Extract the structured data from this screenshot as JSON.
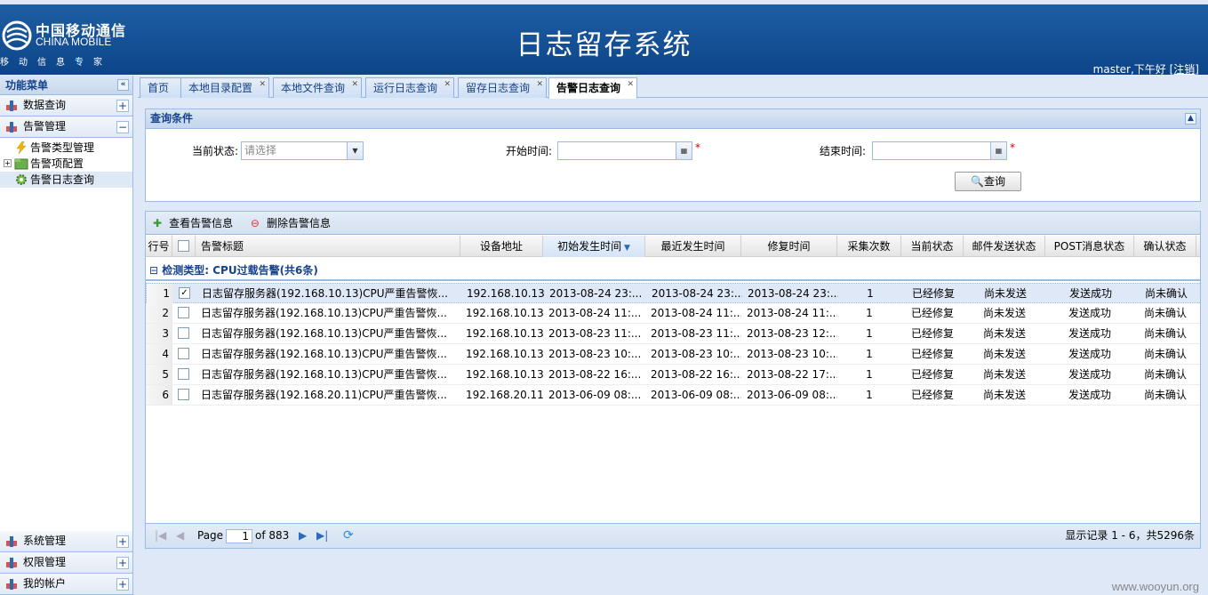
{
  "header": {
    "logo_cn": "中国移动通信",
    "logo_en": "CHINA MOBILE",
    "logo_sub": "移动信息专家",
    "title": "日志留存系统",
    "greeting": "master,下午好",
    "logout": "[注销]"
  },
  "sidebar": {
    "title": "功能菜单",
    "collapse_icon": "«",
    "sections_top": [
      {
        "label": "数据查询",
        "toggle": "+"
      },
      {
        "label": "告警管理",
        "toggle": "−"
      }
    ],
    "tree": [
      {
        "label": "告警类型管理",
        "icon": "lightning-icon"
      },
      {
        "label": "告警项配置",
        "icon": "folder-icon",
        "expander": "+"
      },
      {
        "label": "告警日志查询",
        "icon": "gear-icon"
      }
    ],
    "sections_bottom": [
      {
        "label": "系统管理",
        "toggle": "+"
      },
      {
        "label": "权限管理",
        "toggle": "+"
      },
      {
        "label": "我的帐户",
        "toggle": "+"
      }
    ]
  },
  "tabs": [
    {
      "label": "首页",
      "closable": false
    },
    {
      "label": "本地目录配置",
      "closable": true
    },
    {
      "label": "本地文件查询",
      "closable": true
    },
    {
      "label": "运行日志查询",
      "closable": true
    },
    {
      "label": "留存日志查询",
      "closable": true
    },
    {
      "label": "告警日志查询",
      "closable": true,
      "active": true
    }
  ],
  "query": {
    "title": "查询条件",
    "status_label": "当前状态:",
    "status_placeholder": "请选择",
    "start_label": "开始时间:",
    "end_label": "结束时间:",
    "required_mark": "*",
    "search_button": "查询"
  },
  "grid": {
    "toolbar": {
      "view": "查看告警信息",
      "delete": "删除告警信息"
    },
    "columns": [
      "行号",
      "",
      "告警标题",
      "设备地址",
      "初始发生时间",
      "最近发生时间",
      "修复时间",
      "采集次数",
      "当前状态",
      "邮件发送状态",
      "POST消息状态",
      "确认状态"
    ],
    "group_label": "检测类型: CPU过载告警(共6条)",
    "rows": [
      {
        "n": "1",
        "checked": true,
        "title": "日志留存服务器(192.168.10.13)CPU严重告警恢...",
        "ip": "192.168.10.13",
        "first": "2013-08-24 23:...",
        "last": "2013-08-24 23:...",
        "fix": "2013-08-24 23:...",
        "count": "1",
        "state": "已经修复",
        "mail": "尚未发送",
        "post": "发送成功",
        "confirm": "尚未确认"
      },
      {
        "n": "2",
        "checked": false,
        "title": "日志留存服务器(192.168.10.13)CPU严重告警恢...",
        "ip": "192.168.10.13",
        "first": "2013-08-24 11:...",
        "last": "2013-08-24 11:...",
        "fix": "2013-08-24 11:...",
        "count": "1",
        "state": "已经修复",
        "mail": "尚未发送",
        "post": "发送成功",
        "confirm": "尚未确认"
      },
      {
        "n": "3",
        "checked": false,
        "title": "日志留存服务器(192.168.10.13)CPU严重告警恢...",
        "ip": "192.168.10.13",
        "first": "2013-08-23 11:...",
        "last": "2013-08-23 11:...",
        "fix": "2013-08-23 12:...",
        "count": "1",
        "state": "已经修复",
        "mail": "尚未发送",
        "post": "发送成功",
        "confirm": "尚未确认"
      },
      {
        "n": "4",
        "checked": false,
        "title": "日志留存服务器(192.168.10.13)CPU严重告警恢...",
        "ip": "192.168.10.13",
        "first": "2013-08-23 10:...",
        "last": "2013-08-23 10:...",
        "fix": "2013-08-23 10:...",
        "count": "1",
        "state": "已经修复",
        "mail": "尚未发送",
        "post": "发送成功",
        "confirm": "尚未确认"
      },
      {
        "n": "5",
        "checked": false,
        "title": "日志留存服务器(192.168.10.13)CPU严重告警恢...",
        "ip": "192.168.10.13",
        "first": "2013-08-22 16:...",
        "last": "2013-08-22 16:...",
        "fix": "2013-08-22 17:...",
        "count": "1",
        "state": "已经修复",
        "mail": "尚未发送",
        "post": "发送成功",
        "confirm": "尚未确认"
      },
      {
        "n": "6",
        "checked": false,
        "title": "日志留存服务器(192.168.20.11)CPU严重告警恢...",
        "ip": "192.168.20.11",
        "first": "2013-06-09 08:...",
        "last": "2013-06-09 08:...",
        "fix": "2013-06-09 08:...",
        "count": "1",
        "state": "已经修复",
        "mail": "尚未发送",
        "post": "发送成功",
        "confirm": "尚未确认"
      }
    ]
  },
  "pager": {
    "page_label": "Page",
    "page_value": "1",
    "of_label": "of 883",
    "summary": "显示记录 1 - 6，共5296条"
  },
  "watermark": "www.wooyun.org",
  "colors": {
    "header": "#0d4489",
    "panel_border": "#99bbe8",
    "title_text": "#15428b"
  }
}
